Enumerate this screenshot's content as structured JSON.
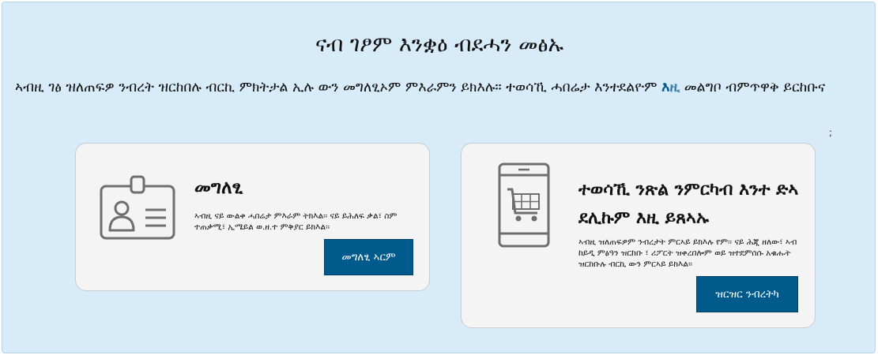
{
  "page": {
    "title": "ናብ ገፆም እንቋዕ ብደሓን መፅኡ",
    "intro_text": "ኣብዚ ገፅ ዝለጠፍዎ ንብረት ዝርከበሉ ብርኪ ምክትታል ኢሉ ውን መግለፂኦም ምእራምን ይክእሉ፡፡ ተወሳኺ ሓበሬታ እንተደልዮም ",
    "intro_link": "እዚ",
    "intro_text_after": " መልግቦ ብምጥዋቅ ይርከቡና",
    "semicolon": ";"
  },
  "cards": [
    {
      "icon": "id-card-icon",
      "title": "መግለፂ",
      "text": "ኣብዚ ናይ ውልቀ ሓበሬታ ምእራም ትክእል፡፡ ናይ ይሕለፍ ቃል፣ ስም ተጠቃሚ፣ ኢሜይል ወ.ዘ.ተ ምቅያር ይክእል፡፡",
      "button": "መግለፂ ኣርም"
    },
    {
      "icon": "shopping-cart-mobile-icon",
      "title": "ተወሳኺ ንጽል ንምርካብ እንተ ድኣ ደሊኩም እዚ ይጸኣኡ",
      "text": "ኣብዚ ዝለጠፍዎም ንብረታት ምርኣይ ይክእሉ የም፡፡ ናይ ሕጂ ዘለው፣ ኣብ ከይዲ ምፅዓን ዝርከቡ ፣ ሪፖርት ዝቀረበሎም ወይ ዝተደምሰሱ አቁሑት ዝርከቡሉ ብርኪ ውን ምርኣይ ይክእል፡፡",
      "button": "ዝርዝር ንብረትካ"
    }
  ],
  "colors": {
    "panel_bg": "#d7ebf8",
    "card_bg": "#f4f4f5",
    "button_bg": "#005a8c",
    "link": "#005a8c"
  }
}
